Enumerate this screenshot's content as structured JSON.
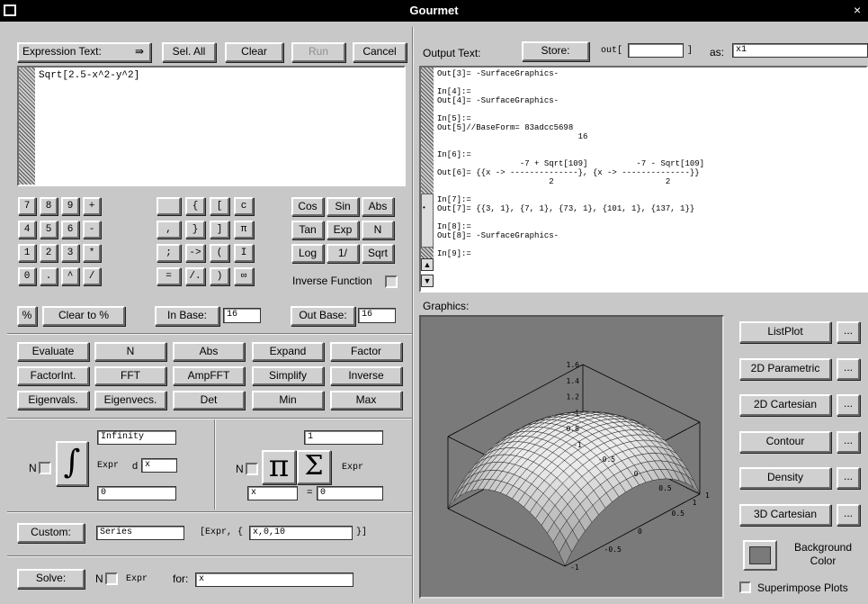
{
  "window": {
    "title": "Gourmet",
    "close_glyph": "×"
  },
  "expression": {
    "dropdown_label": "Expression Text:",
    "select_all": "Sel. All",
    "clear": "Clear",
    "run": "Run",
    "cancel": "Cancel",
    "text": "Sqrt[2.5-x^2-y^2]"
  },
  "keypad": {
    "numeric": [
      [
        "7",
        "8",
        "9",
        "+"
      ],
      [
        "4",
        "5",
        "6",
        "-"
      ],
      [
        "1",
        "2",
        "3",
        "*"
      ],
      [
        "0",
        ".",
        "^",
        "/"
      ]
    ],
    "symbols": [
      [
        "",
        "{",
        "[",
        "c"
      ],
      [
        ",",
        "}",
        "]",
        "π"
      ],
      [
        ";",
        "->",
        "(",
        "I"
      ],
      [
        "=",
        "/.",
        ")",
        "∞"
      ]
    ],
    "functions": [
      [
        "Cos",
        "Sin",
        "Abs"
      ],
      [
        "Tan",
        "Exp",
        "N"
      ],
      [
        "Log",
        "1/",
        "Sqrt"
      ]
    ],
    "inverse_label": "Inverse Function",
    "percent": "%",
    "clear_to_percent": "Clear to %",
    "in_base_label": "In Base:",
    "in_base_value": "16",
    "out_base_label": "Out Base:",
    "out_base_value": "16"
  },
  "operations": [
    [
      "Evaluate",
      "N",
      "Abs",
      "Expand",
      "Factor"
    ],
    [
      "FactorInt.",
      "FFT",
      "AmpFFT",
      "Simplify",
      "Inverse"
    ],
    [
      "Eigenvals.",
      "Eigenvecs.",
      "Det",
      "Min",
      "Max"
    ]
  ],
  "integral": {
    "n_label": "N",
    "upper": "Infinity",
    "expr_label": "Expr",
    "d_label": "d",
    "variable": "x",
    "lower": "0",
    "symbol": "∫"
  },
  "sumprod": {
    "n_label": "N",
    "pi_symbol": "π",
    "sigma_symbol": "Σ",
    "expr_label": "Expr",
    "upper": "1",
    "variable": "x",
    "equals": "=",
    "lower": "0"
  },
  "custom": {
    "button": "Custom:",
    "function": "Series",
    "template_left": "[Expr, {",
    "args": "x,0,10",
    "template_right": "}]"
  },
  "solve": {
    "button": "Solve:",
    "n_label": "N",
    "expr_label": "Expr",
    "for_label": "for:",
    "variable": "x"
  },
  "output": {
    "label": "Output Text:",
    "store": "Store:",
    "out_prefix": "out[",
    "out_index": "",
    "out_suffix": "]",
    "as_label": "as:",
    "as_value": "x1",
    "text": "Out[3]= -SurfaceGraphics-\n\nIn[4]:=\nOut[4]= -SurfaceGraphics-\n\nIn[5]:=\nOut[5]//BaseForm= 83adcc5698\n                             16\n\nIn[6]:=\n                 -7 + Sqrt[109]          -7 - Sqrt[109]\nOut[6]= {{x -> --------------}, {x -> --------------}}\n                       2                       2\n\nIn[7]:=\nOut[7]= {{3, 1}, {7, 1}, {73, 1}, {101, 1}, {137, 1}}\n\nIn[8]:=\nOut[8]= -SurfaceGraphics-\n\nIn[9]:="
  },
  "graphics": {
    "label": "Graphics:",
    "plot_buttons": [
      "ListPlot",
      "2D Parametric",
      "2D Cartesian",
      "Contour",
      "Density",
      "3D Cartesian"
    ],
    "more": "...",
    "background_color": "Background Color",
    "superimpose": "Superimpose Plots",
    "axes": {
      "z_ticks": [
        "1.6",
        "1.4",
        "1.2",
        "1",
        "0.8"
      ],
      "x_ticks": [
        "-1",
        "-0.5",
        "0",
        "0.5",
        "1"
      ],
      "y_ticks": [
        "1",
        "0.5",
        "0",
        "-0.5",
        "-1"
      ]
    }
  }
}
